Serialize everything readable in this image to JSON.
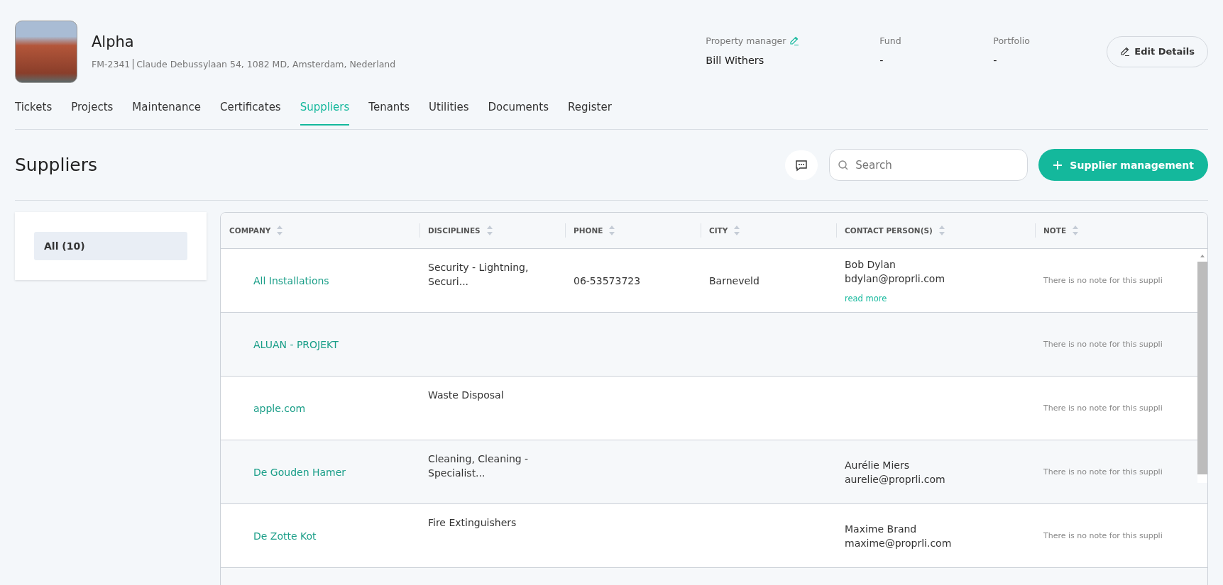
{
  "property": {
    "name": "Alpha",
    "code": "FM-2341",
    "address": "Claude Debussylaan 54, 1082 MD, Amsterdam, Nederland"
  },
  "meta": [
    {
      "label": "Property manager",
      "value": "Bill Withers",
      "editable": true
    },
    {
      "label": "Fund",
      "value": "-",
      "editable": false
    },
    {
      "label": "Portfolio",
      "value": "-",
      "editable": false
    }
  ],
  "edit_button": "Edit Details",
  "tabs": [
    {
      "label": "Tickets",
      "selected": false
    },
    {
      "label": "Projects",
      "selected": false
    },
    {
      "label": "Maintenance",
      "selected": false
    },
    {
      "label": "Certificates",
      "selected": false
    },
    {
      "label": "Suppliers",
      "selected": true
    },
    {
      "label": "Tenants",
      "selected": false
    },
    {
      "label": "Utilities",
      "selected": false
    },
    {
      "label": "Documents",
      "selected": false
    },
    {
      "label": "Register",
      "selected": false
    }
  ],
  "page_title": "Suppliers",
  "search": {
    "placeholder": "Search"
  },
  "add_button": "Supplier management",
  "filters": [
    {
      "label": "All (10)",
      "selected": true
    }
  ],
  "table": {
    "columns": [
      "COMPANY",
      "DISCIPLINES",
      "PHONE",
      "CITY",
      "CONTACT PERSON(S)",
      "NOTE"
    ],
    "rows": [
      {
        "company": "All Installations",
        "disciplines": "Security - Lightning, Securi...",
        "phone": "06-53573723",
        "city": "Barneveld",
        "contacts": [
          "Bob Dylan",
          "bdylan@proprli.com"
        ],
        "read_more": "read more",
        "note": "There is no note for this suppli"
      },
      {
        "company": "ALUAN - PROJEKT",
        "disciplines": "",
        "phone": "",
        "city": "",
        "contacts": [],
        "note": "There is no note for this suppli"
      },
      {
        "company": "apple.com",
        "disciplines": "Waste Disposal",
        "phone": "",
        "city": "",
        "contacts": [],
        "note": "There is no note for this suppli"
      },
      {
        "company": "De Gouden Hamer",
        "disciplines": "Cleaning, Cleaning - Specialist...",
        "phone": "",
        "city": "",
        "contacts": [
          "Aurélie Miers",
          "aurelie@proprli.com"
        ],
        "note": "There is no note for this suppli"
      },
      {
        "company": "De Zotte Kot",
        "disciplines": "Fire Extinguishers",
        "phone": "",
        "city": "",
        "contacts": [
          "Maxime Brand",
          "maxime@proprli.com"
        ],
        "note": "There is no note for this suppli"
      }
    ]
  }
}
